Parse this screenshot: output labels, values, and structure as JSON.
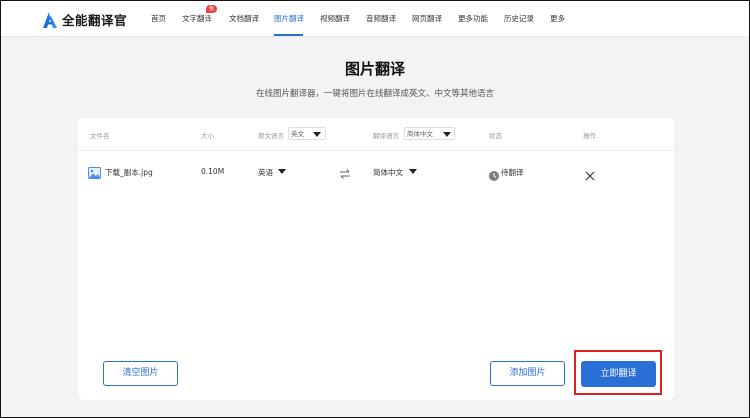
{
  "app": {
    "name": "全能翻译官"
  },
  "nav": {
    "items": [
      {
        "label": "首页"
      },
      {
        "label": "文字翻译"
      },
      {
        "label": "文档翻译"
      },
      {
        "label": "图片翻译"
      },
      {
        "label": "视频翻译"
      },
      {
        "label": "音频翻译"
      },
      {
        "label": "网页翻译"
      },
      {
        "label": "更多功能"
      },
      {
        "label": "历史记录"
      },
      {
        "label": "更多"
      }
    ],
    "active": "图片翻译",
    "free_badge": "免费"
  },
  "page": {
    "title": "图片翻译",
    "subtitle": "在线图片翻译器，一键将图片在线翻译成英文、中文等其他语言"
  },
  "table": {
    "headers": {
      "filename": "文件名",
      "size": "大小",
      "source_lang": "原文语言",
      "target_lang": "翻译语言",
      "status": "状态",
      "action": "操作"
    },
    "source_lang_default": "英文",
    "target_lang_default": "简体中文",
    "rows": [
      {
        "filename": "下载_副本.jpg",
        "size": "0.10M",
        "source_lang": "英语",
        "target_lang": "简体中文",
        "status": "待翻译"
      }
    ]
  },
  "buttons": {
    "clear": "清空图片",
    "add": "添加图片",
    "translate": "立即翻译"
  },
  "colors": {
    "accent": "#2a6fd6",
    "badge": "#e8453c",
    "highlight": "#e02020"
  },
  "icons": [
    "logo-icon",
    "image-file-icon",
    "swap-icon",
    "clock-icon",
    "close-icon",
    "caret-down-icon"
  ]
}
